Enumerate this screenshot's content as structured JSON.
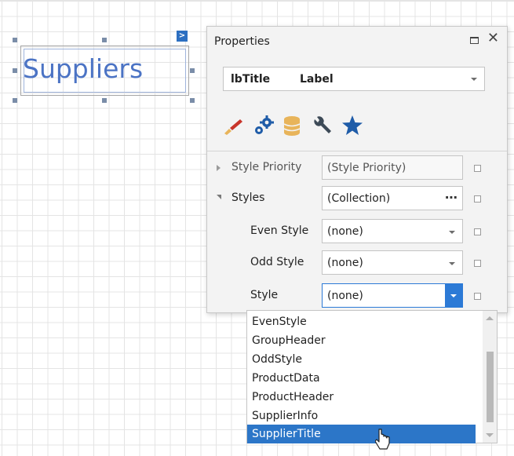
{
  "design_surface": {
    "label_text": "Suppliers",
    "smart_tag_glyph": ">"
  },
  "properties_panel": {
    "title": "Properties",
    "object_name": "lbTitle",
    "object_type": "Label",
    "tab_icons": [
      "brush-icon",
      "gears-icon",
      "database-icon",
      "wrench-icon",
      "star-icon"
    ],
    "rows": [
      {
        "label": "Style Priority",
        "value": "(Style Priority)"
      },
      {
        "label": "Styles",
        "value": "(Collection)",
        "button": "⋯"
      },
      {
        "label": "Even Style",
        "value": "(none)"
      },
      {
        "label": "Odd Style",
        "value": "(none)"
      },
      {
        "label": "Style",
        "value": "(none)"
      }
    ]
  },
  "dropdown": {
    "items": [
      "EvenStyle",
      "GroupHeader",
      "OddStyle",
      "ProductData",
      "ProductHeader",
      "SupplierInfo",
      "SupplierTitle"
    ],
    "selected": "SupplierTitle"
  },
  "colors": {
    "accent": "#2c7ad6",
    "selection": "#2c76c8",
    "label_text": "#4b73c4",
    "brush_red": "#c8352b",
    "icon_blue": "#1f5ca8",
    "db_gold": "#e8b45a",
    "wrench_dark": "#3d4a57"
  }
}
